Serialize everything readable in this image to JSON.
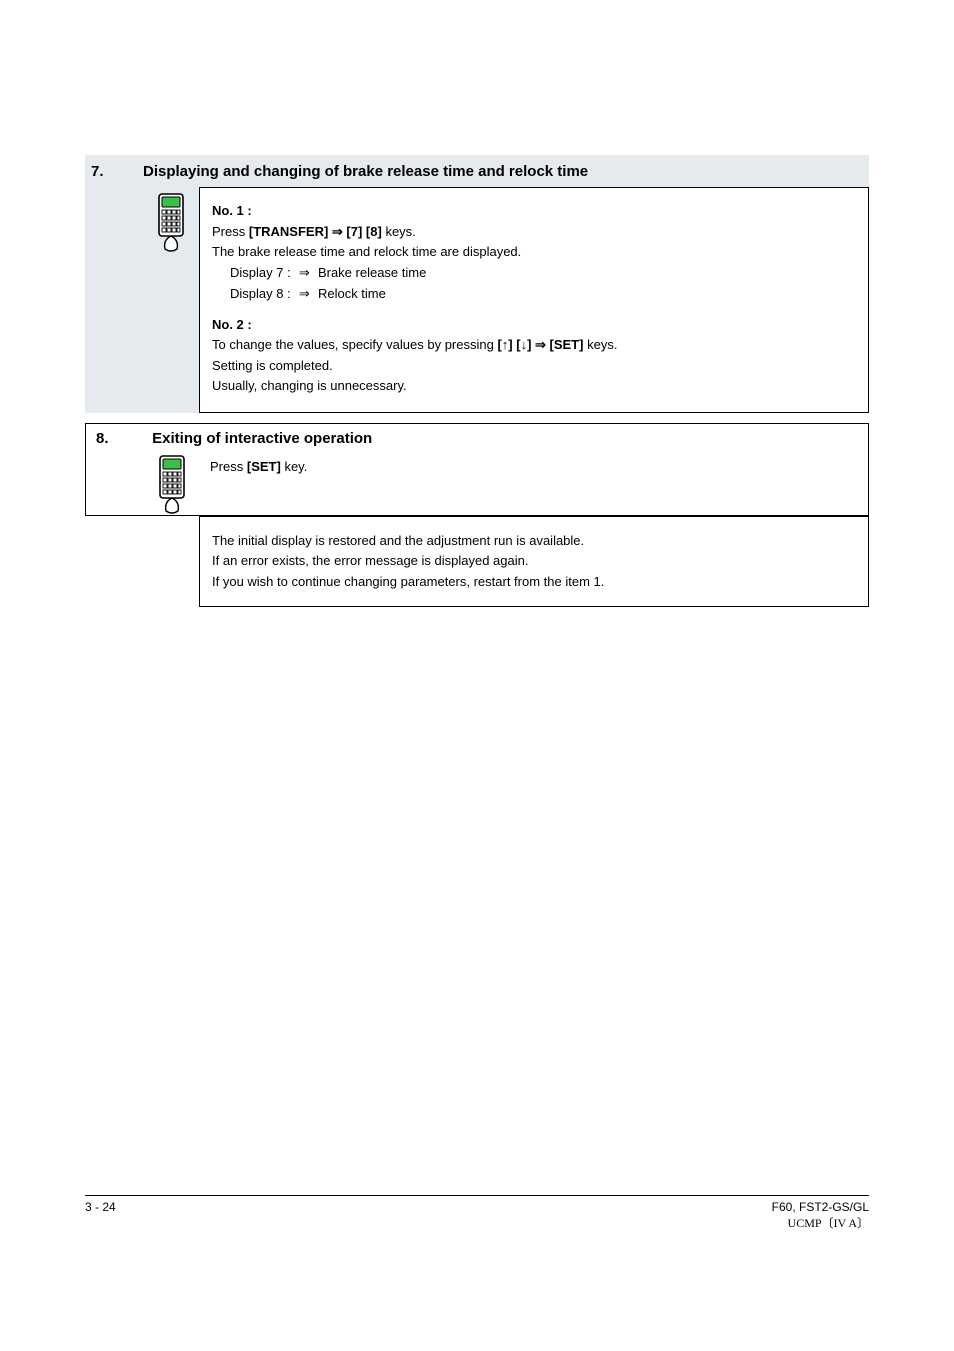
{
  "section7": {
    "number": "7.",
    "title": "Displaying and changing of brake release time and relock time",
    "no1": {
      "label": "No. 1 :",
      "line1_pre": "Press",
      "line1_bold": "[TRANSFER] ⇒ [7] [8]",
      "line1_post": "keys.",
      "line2": "The brake release time and relock time are displayed.",
      "disp_7_label": "Display 7 :",
      "disp_7_value": "Brake release time",
      "disp_8_label": "Display 8 :",
      "disp_8_value": "Relock time"
    },
    "no2": {
      "label": "No. 2 :",
      "line1": "To change the values, specify values by pressing",
      "line1_bold": "[↑] [↓] ⇒ [SET]",
      "line1_post": "keys.",
      "line2": "Setting is completed.",
      "line3": "Usually, changing is unnecessary."
    }
  },
  "section8": {
    "number": "8.",
    "title": "Exiting of interactive operation",
    "intro_pre": "Press",
    "intro_bold": "[SET]",
    "intro_post": "key.",
    "box_l1": "The initial display is restored and the adjustment run is available.",
    "box_l2": "If an error exists, the error message is displayed again.",
    "box_l3": "If you wish to continue changing parameters, restart from the item 1."
  },
  "footer": {
    "left": "3 - 24",
    "right_model": "F60, FST2-GS/GL",
    "right_series": "UCMP〔IV A〕"
  }
}
